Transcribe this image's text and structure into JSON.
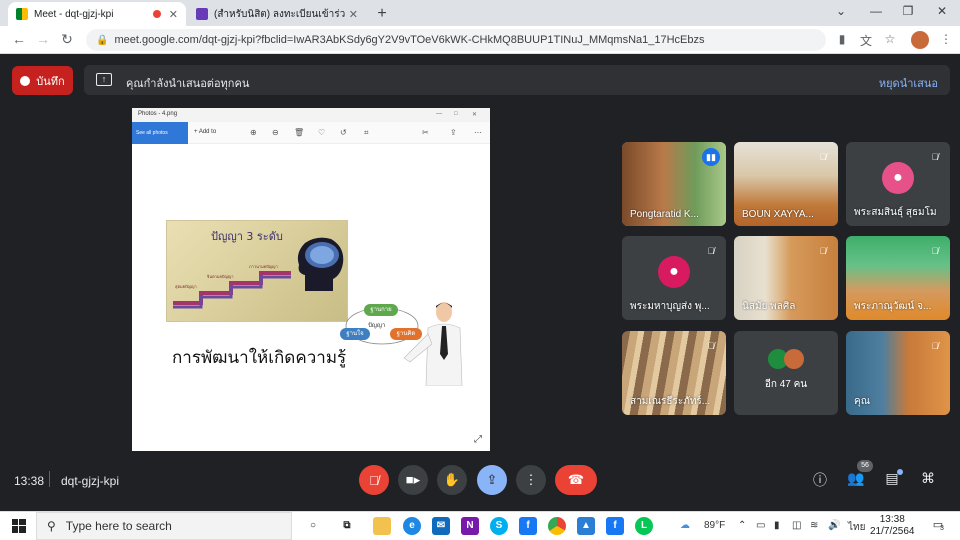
{
  "browser": {
    "tabs": [
      {
        "title": "Meet - dqt-gjzj-kpi",
        "active": true
      },
      {
        "title": "(สำหรับนิสิต) ลงทะเบียนเข้าร่วมกิจกรรม",
        "active": false
      }
    ],
    "url": "meet.google.com/dqt-gjzj-kpi?fbclid=IwAR3AbKSdy6gY2V9vTOeV6kWK-CHkMQ8BUUP1TINuJ_MMqmsNa1_17HcEbzs"
  },
  "header": {
    "record_label": "บันทึก",
    "presenting_text": "คุณกำลังนำเสนอต่อทุกคน",
    "stop_presenting": "หยุดนำเสนอ"
  },
  "shared_screen": {
    "window_title": "Photos - 4.png",
    "see_all_photos": "See all photos",
    "add_to": "Add to",
    "slide_title": "ปัญญา 3 ระดับ",
    "stair_labels": [
      "สุตมยปัญญา",
      "จินตามยปัญญา",
      "ภาวนามยปัญญา"
    ],
    "caption": "การพัฒนาให้เกิดความรู้",
    "cloud_top": "ฐานกาย",
    "cloud_mid": "ปัญญา",
    "cloud_left": "ฐานใจ",
    "cloud_right": "ฐานคิด"
  },
  "participants": [
    {
      "name": "Pongtaratid K...",
      "mic": "speaking"
    },
    {
      "name": "BOUN XAYYA...",
      "mic": "off"
    },
    {
      "name": "พระสมสินธุ์ สุธมโม",
      "mic": "off",
      "initial": "",
      "color": "#e7518a"
    },
    {
      "name": "พระมหาบุญส่ง พุ...",
      "mic": "off",
      "initial": "",
      "color": "#d81b60"
    },
    {
      "name": "นิสมัย พลศิล",
      "mic": "off"
    },
    {
      "name": "พระภาณุวัฒน์ จ...",
      "mic": "off"
    },
    {
      "name": "สามเณรธีระภัทร์...",
      "mic": "off"
    },
    {
      "name": "อีก 47 คน",
      "mic": "none"
    },
    {
      "name": "คุณ",
      "mic": "off"
    }
  ],
  "bottom": {
    "time": "13:38",
    "meeting_code": "dqt-gjzj-kpi",
    "participant_count": "56"
  },
  "taskbar": {
    "search_placeholder": "Type here to search",
    "weather": "89°F",
    "language": "ไทย",
    "time": "13:38",
    "date": "21/7/2564",
    "notification_count": "3"
  },
  "colors": {
    "meet_bg": "#202124",
    "record_red": "#c5221f",
    "stop_link": "#8ab4f8",
    "hangup_red": "#ea4335",
    "photos_blue": "#2f78d8"
  }
}
